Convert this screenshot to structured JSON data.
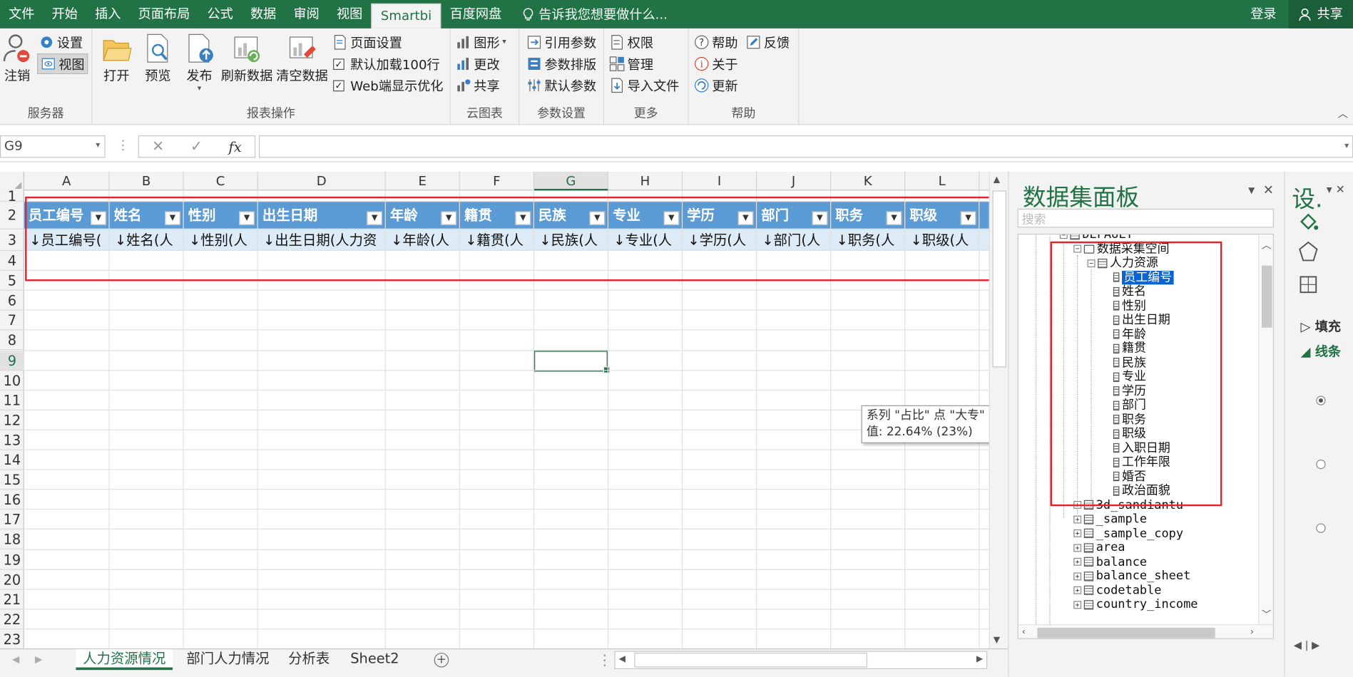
{
  "menubar": {
    "tabs": [
      "文件",
      "开始",
      "插入",
      "页面布局",
      "公式",
      "数据",
      "审阅",
      "视图",
      "Smartbi",
      "百度网盘"
    ],
    "active_tab": "Smartbi",
    "tell_me": "告诉我您想要做什么...",
    "login": "登录",
    "share": "共享"
  },
  "ribbon": {
    "server": {
      "logout": "注销",
      "settings": "设置",
      "view": "视图",
      "label": "服务器"
    },
    "report": {
      "open": "打开",
      "preview": "预览",
      "publish": "发布",
      "refresh": "刷新数据",
      "clear": "清空数据",
      "page_setup": "页面设置",
      "default_load": "默认加载100行",
      "web_opt": "Web端显示优化",
      "label": "报表操作"
    },
    "cloud": {
      "chart": "图形",
      "change": "更改",
      "share": "共享",
      "label": "云图表"
    },
    "params": {
      "ref": "引用参数",
      "arrange": "参数排版",
      "default": "默认参数",
      "label": "参数设置"
    },
    "more": {
      "perm": "权限",
      "manage": "管理",
      "import": "导入文件",
      "label": "更多"
    },
    "help": {
      "help": "帮助",
      "feedback": "反馈",
      "about": "关于",
      "update": "更新",
      "label": "帮助"
    }
  },
  "formula": {
    "namebox": "G9",
    "fx": "fx"
  },
  "grid": {
    "columns": [
      "A",
      "B",
      "C",
      "D",
      "E",
      "F",
      "G",
      "H",
      "I",
      "J",
      "K",
      "L"
    ],
    "rows": [
      "1",
      "2",
      "3",
      "4",
      "5",
      "6",
      "7",
      "8",
      "9",
      "10",
      "11",
      "12",
      "13",
      "14",
      "15",
      "16",
      "17",
      "18",
      "19",
      "20",
      "21",
      "22",
      "23"
    ],
    "selected_cell": "G9",
    "header_cells": [
      "员工编号",
      "姓名",
      "性别",
      "出生日期",
      "年龄",
      "籍贯",
      "民族",
      "专业",
      "学历",
      "部门",
      "职务",
      "职级"
    ],
    "data_cells": [
      "↓员工编号(",
      "↓姓名(人",
      "↓性别(人",
      "↓出生日期(人力资",
      "↓年龄(人",
      "↓籍贯(人",
      "↓民族(人",
      "↓专业(人",
      "↓学历(人",
      "↓部门(人",
      "↓职务(人",
      "↓职级(人"
    ]
  },
  "tooltip": {
    "line1": "系列 \"占比\" 点 \"大专\"",
    "line2": "值: 22.64% (23%)"
  },
  "sheets": [
    "人力资源情况",
    "部门人力情况",
    "分析表",
    "Sheet2"
  ],
  "active_sheet": "人力资源情况",
  "panel": {
    "title": "数据集面板",
    "search_placeholder": "搜索",
    "tree": {
      "root": "DEFAULT",
      "space": "数据采集空间",
      "table": "人力资源",
      "fields": [
        "员工编号",
        "姓名",
        "性别",
        "出生日期",
        "年龄",
        "籍贯",
        "民族",
        "专业",
        "学历",
        "部门",
        "职务",
        "职级",
        "入职日期",
        "工作年限",
        "婚否",
        "政治面貌"
      ],
      "others": [
        "3d_sandiantu",
        "_sample",
        "_sample_copy",
        "area",
        "balance",
        "balance_sheet",
        "codetable",
        "country_income"
      ]
    }
  },
  "panel2": {
    "title": "设.",
    "item1": "填充",
    "item2": "线条"
  },
  "colors": {
    "accent": "#217346",
    "header_blue": "#5b9bd5",
    "data_blue": "#ddebf7",
    "highlight": "#e8212b"
  }
}
